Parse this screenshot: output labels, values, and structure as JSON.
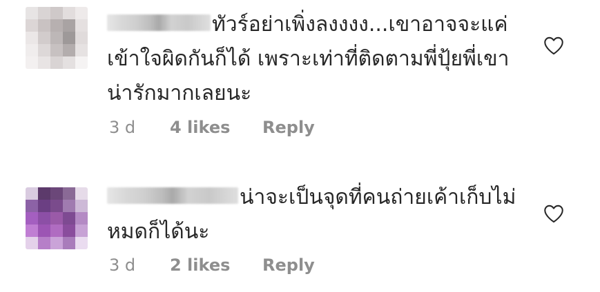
{
  "comments": [
    {
      "text": "ทัวร์อย่าเพิ่งลงงงง...เขาอาจจะแค่เข้าใจผิดกันก็ได้ เพราะเท่าที่ติดตามพี่ปุ้ยพี่เขาน่ารักมากเลยนะ",
      "time": "3 d",
      "likes": "4 likes",
      "reply": "Reply",
      "like_icon": "heart-outline-icon",
      "avatar_colors": [
        "#e7e4e4",
        "#d9d4d4",
        "#cfc9c9",
        "#e2dddd",
        "#eeeaea",
        "#dcd6d6",
        "#c9c2c2",
        "#b7b0b0",
        "#a9a3a3",
        "#e5e0e0",
        "#ebe7e7",
        "#d2cccc",
        "#bdb7b7",
        "#9e9999",
        "#e0dbdb",
        "#f0eded",
        "#ddd8d8",
        "#c7c1c1",
        "#b3adad",
        "#e6e2e2",
        "#f3f0f0",
        "#e8e4e4",
        "#d9d4d4",
        "#e4e0e0",
        "#f5f3f3"
      ]
    },
    {
      "text": "น่าจะเป็นจุดที่คนถ่ายเค้าเก็บไม่หมดก็ได้นะ",
      "time": "3 d",
      "likes": "2 likes",
      "reply": "Reply",
      "like_icon": "heart-outline-icon",
      "avatar_colors": [
        "#d9cbe0",
        "#5c3a6b",
        "#6b4779",
        "#8a6a96",
        "#e6dbe9",
        "#8c62a6",
        "#6b3f83",
        "#7a4b8c",
        "#a07bb0",
        "#cdb9d7",
        "#a45fc0",
        "#8c4fa6",
        "#9a5aa8",
        "#7e4a92",
        "#b48ac4",
        "#c07ed3",
        "#9c55b4",
        "#b06cc1",
        "#8a4d9d",
        "#c7a2d5",
        "#e4d1ea",
        "#b67fc8",
        "#caa3d8",
        "#a97cbb",
        "#eadcf0"
      ]
    }
  ]
}
